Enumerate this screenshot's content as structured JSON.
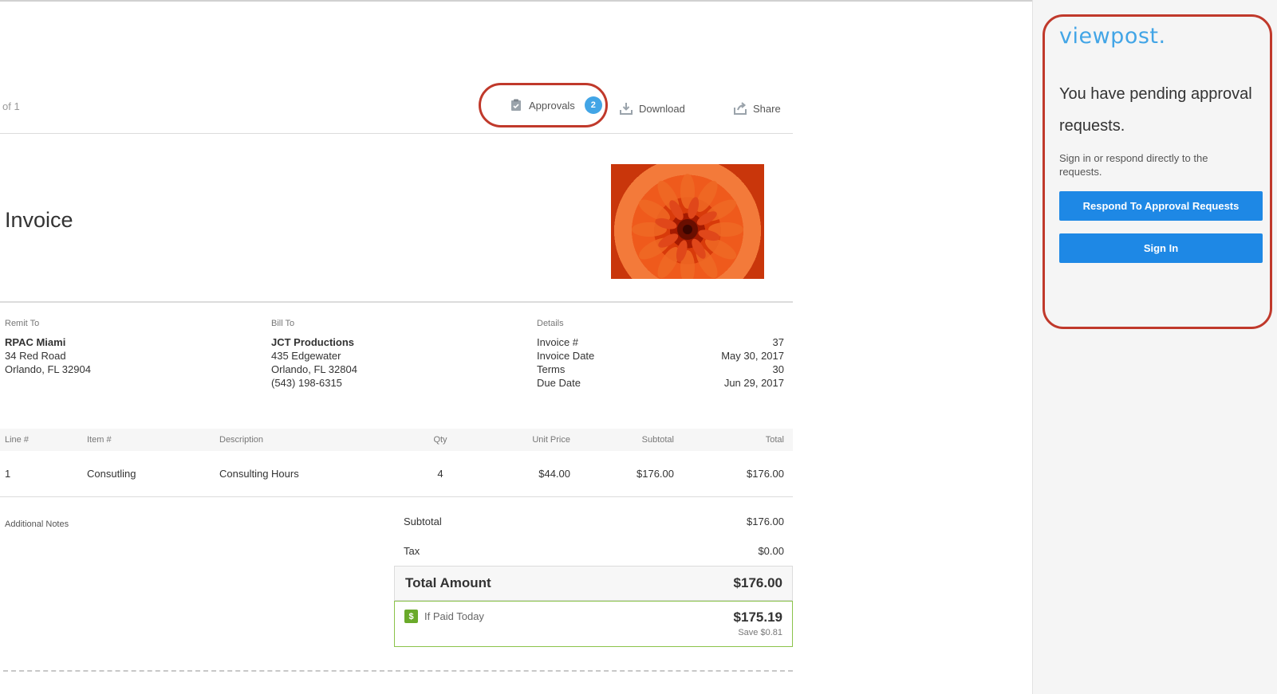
{
  "toolbar": {
    "page_of": "of 1",
    "approvals_label": "Approvals",
    "approvals_count": "2",
    "download_label": "Download",
    "share_label": "Share"
  },
  "invoice": {
    "title": "Invoice"
  },
  "remit_to": {
    "label": "Remit To",
    "name": "RPAC Miami",
    "address1": "34 Red Road",
    "address2": "Orlando, FL 32904"
  },
  "bill_to": {
    "label": "Bill To",
    "name": "JCT Productions",
    "address1": "435 Edgewater",
    "address2": "Orlando, FL 32804",
    "phone": "(543) 198-6315"
  },
  "details": {
    "label": "Details",
    "rows": [
      {
        "label": "Invoice #",
        "value": "37"
      },
      {
        "label": "Invoice Date",
        "value": "May 30, 2017"
      },
      {
        "label": "Terms",
        "value": "30"
      },
      {
        "label": "Due Date",
        "value": "Jun 29, 2017"
      }
    ]
  },
  "items": {
    "headers": {
      "line": "Line #",
      "item": "Item #",
      "description": "Description",
      "qty": "Qty",
      "unit_price": "Unit Price",
      "subtotal": "Subtotal",
      "total": "Total"
    },
    "rows": [
      {
        "line": "1",
        "item": "Consutling",
        "description": "Consulting Hours",
        "qty": "4",
        "unit_price": "$44.00",
        "subtotal": "$176.00",
        "total": "$176.00"
      }
    ]
  },
  "notes": {
    "label": "Additional Notes"
  },
  "summary": {
    "subtotal_label": "Subtotal",
    "subtotal_value": "$176.00",
    "tax_label": "Tax",
    "tax_value": "$0.00",
    "total_label": "Total Amount",
    "total_value": "$176.00",
    "paid_today_label": "If Paid Today",
    "paid_today_icon": "$",
    "paid_today_value": "$175.19",
    "save_text": "Save $0.81"
  },
  "sidebar": {
    "logo": "viewpost.",
    "headline": "You have pending approval requests.",
    "subtext": "Sign in or respond directly to the requests.",
    "respond_button": "Respond To Approval Requests",
    "signin_button": "Sign In"
  },
  "colors": {
    "accent": "#1e88e5",
    "logo": "#42a5e6",
    "highlight": "#c0392b",
    "discount": "#8bc34a"
  }
}
